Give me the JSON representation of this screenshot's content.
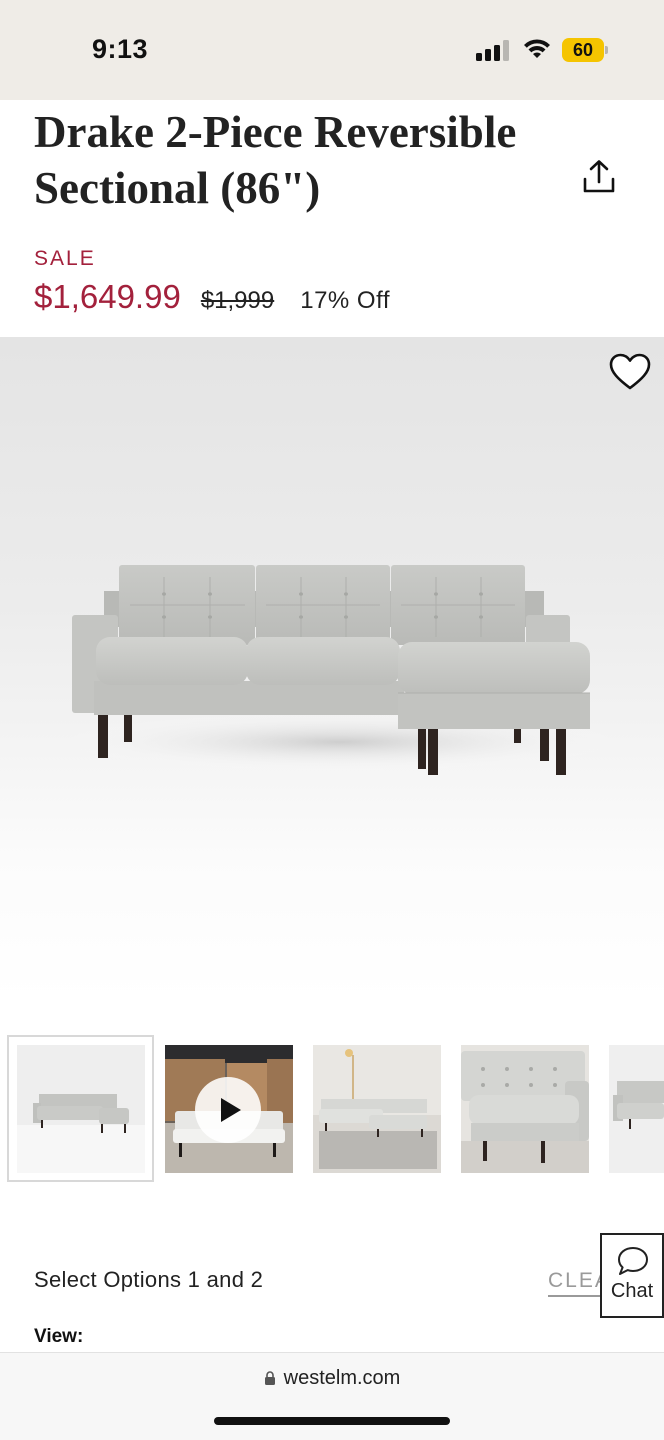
{
  "status_bar": {
    "time": "9:13",
    "battery": "60",
    "colors": {
      "background": "#efece7",
      "battery": "#f5c400"
    }
  },
  "product": {
    "title": "Drake 2-Piece Reversible Sectional (86\")",
    "sale_label": "SALE",
    "sale_price": "$1,649.99",
    "original_price": "$1,999",
    "discount": "17% Off",
    "colors": {
      "sale": "#a3213c"
    }
  },
  "icons": {
    "share": "share-icon",
    "favorite": "heart-icon",
    "play": "play-icon",
    "chat": "chat-bubble-icon",
    "lock": "lock-icon"
  },
  "gallery": {
    "thumbnails": [
      {
        "name": "studio-front-view",
        "selected": true
      },
      {
        "name": "assembly-video",
        "video": true
      },
      {
        "name": "room-scene-living-room"
      },
      {
        "name": "closeup-chaise"
      },
      {
        "name": "partial-side-view"
      }
    ]
  },
  "options": {
    "heading": "Select Options 1 and 2",
    "clear": "CLEAR",
    "view_label": "View:"
  },
  "chat": {
    "label": "Chat"
  },
  "browser": {
    "url": "westelm.com"
  }
}
